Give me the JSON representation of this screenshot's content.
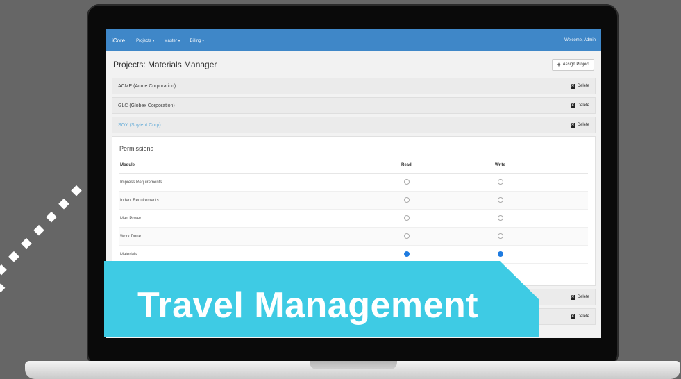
{
  "app": {
    "brand": "iCore",
    "welcome": "Welcome, Admin"
  },
  "nav": {
    "items": [
      "Projects ▾",
      "Master ▾",
      "Billing ▾"
    ]
  },
  "page": {
    "title": "Projects: Materials Manager",
    "assign_label": "Assign Project"
  },
  "projects": [
    {
      "name": "ACME (Acme Corporation)",
      "delete_label": "Delete"
    },
    {
      "name": "GLC (Globex Corporation)",
      "delete_label": "Delete"
    },
    {
      "name": "SOY (Soylent Corp)",
      "delete_label": "Delete"
    }
  ],
  "permissions": {
    "title": "Permissions",
    "columns": [
      "Module",
      "Read",
      "Write"
    ],
    "rows": [
      {
        "module": "Impress Requirements",
        "read": false,
        "write": false
      },
      {
        "module": "Indent Requirements",
        "read": false,
        "write": false
      },
      {
        "module": "Man Power",
        "read": false,
        "write": false
      },
      {
        "module": "Work Done",
        "read": false,
        "write": false
      },
      {
        "module": "Materials",
        "read": true,
        "write": true
      }
    ]
  },
  "lower_rows": [
    {
      "delete_label": "Delete"
    },
    {
      "delete_label": "Delete"
    }
  ],
  "banner": {
    "text": "Travel Management",
    "color": "#3ecbe4"
  },
  "colors": {
    "background": "#666666",
    "nav": "#3f87c8",
    "accent_radio": "#1e7be0"
  }
}
